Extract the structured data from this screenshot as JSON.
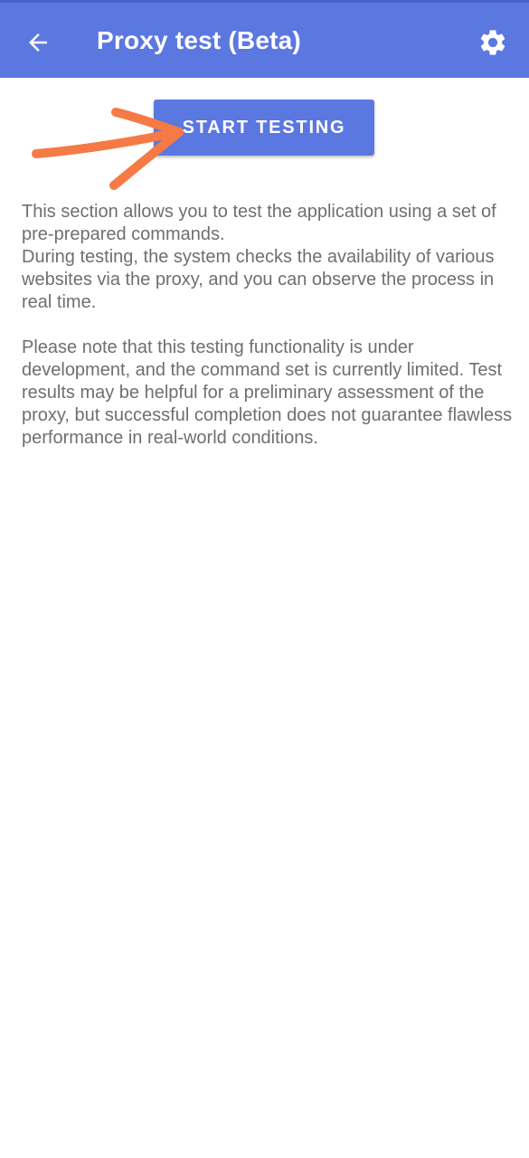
{
  "app_bar": {
    "title": "Proxy test (Beta)",
    "back_icon": "arrow-left-icon",
    "settings_icon": "gear-icon",
    "color": "#5b77e0"
  },
  "actions": {
    "start_label": "START TESTING"
  },
  "annotation": {
    "type": "hand-drawn arrow",
    "color": "#f57a45",
    "points_to": "start-testing-button"
  },
  "description": {
    "line_1": "This section allows you to test the application using a set of pre-prepared commands.",
    "line_2": "During testing, the system checks the availability of various websites via the proxy, and you can observe the process in real time.",
    "paragraph_2": "Please note that this testing functionality is under development, and the command set is currently limited. Test results may be helpful for a preliminary assessment of the proxy, but successful completion does not guarantee flawless performance in real-world conditions."
  }
}
